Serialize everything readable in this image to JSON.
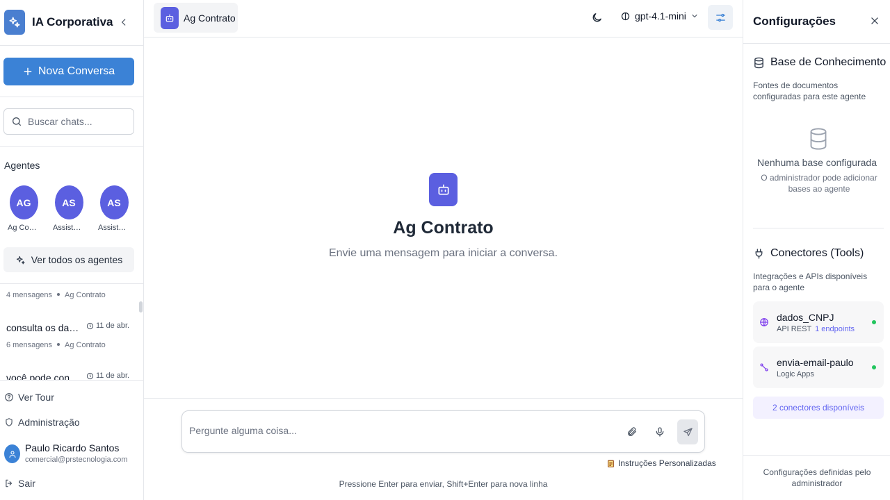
{
  "sidebar": {
    "brand_title": "IA Corporativa",
    "new_chat_label": "Nova Conversa",
    "search_placeholder": "Buscar chats...",
    "agents_title": "Agentes",
    "agents": [
      {
        "initials": "AG",
        "name": "Ag Contrato"
      },
      {
        "initials": "AS",
        "name": "Assistente"
      },
      {
        "initials": "AS",
        "name": "Assistente"
      }
    ],
    "all_agents_label": "Ver todos os agentes",
    "chats": [
      {
        "count": "4 mensagens",
        "agent": "Ag Contrato"
      },
      {
        "title": "consulta os dados...",
        "date": "11 de abr.",
        "count": "6 mensagens",
        "agent": "Ag Contrato"
      },
      {
        "title": "você pode consu...",
        "date": "11 de abr."
      }
    ],
    "tour_label": "Ver Tour",
    "admin_label": "Administração",
    "user": {
      "name": "Paulo Ricardo Santos",
      "email": "comercial@prstecnologia.com"
    },
    "logout_label": "Sair"
  },
  "topbar": {
    "agent_name": "Ag Contrato",
    "model": "gpt-4.1-mini"
  },
  "main": {
    "empty_title": "Ag Contrato",
    "empty_subtitle": "Envie uma mensagem para iniciar a conversa.",
    "input_placeholder": "Pergunte alguma coisa...",
    "instructions_label": "Instruções Personalizadas",
    "hint": "Pressione Enter para enviar, Shift+Enter para nova linha"
  },
  "panel": {
    "title": "Configurações",
    "kb": {
      "title": "Base de Conhecimento",
      "description": "Fontes de documentos configuradas para este agente",
      "empty_title": "Nenhuma base configurada",
      "empty_desc": "O administrador pode adicionar bases ao agente"
    },
    "connectors": {
      "title": "Conectores (Tools)",
      "description": "Integrações e APIs disponíveis para o agente",
      "items": [
        {
          "name": "dados_CNPJ",
          "type": "API REST",
          "endpoints": "1 endpoints",
          "status": "active"
        },
        {
          "name": "envia-email-paulo",
          "type": "Logic Apps",
          "status": "active"
        }
      ],
      "count_label": "2 conectores disponíveis"
    },
    "footer": "Configurações definidas pelo administrador"
  },
  "colors": {
    "primary": "#3b82d6",
    "agent_accent": "#5b5fe0",
    "status_active": "#22c55e",
    "link": "#6366f1"
  }
}
